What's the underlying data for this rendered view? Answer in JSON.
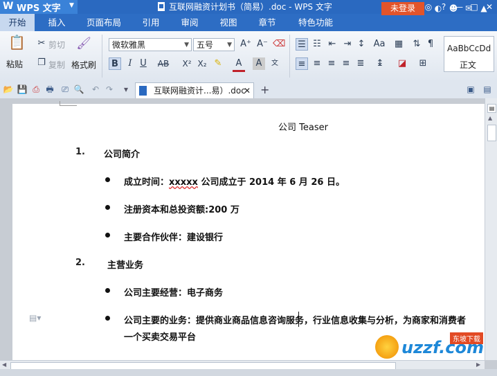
{
  "titlebar": {
    "app_name": "WPS 文字",
    "doc_title": "互联网融资计划书（简易）.doc - WPS 文字",
    "controls": [
      "◎",
      "?",
      "—",
      "□",
      "✕"
    ]
  },
  "menu": {
    "tabs": [
      "开始",
      "插入",
      "页面布局",
      "引用",
      "审阅",
      "视图",
      "章节",
      "特色功能"
    ],
    "active": "开始",
    "login": "未登录",
    "icons": [
      "◐",
      "☻",
      "✉",
      "▲"
    ]
  },
  "ribbon": {
    "paste": "粘贴",
    "cut": "剪切",
    "copy": "复制",
    "format_painter": "格式刷",
    "font_name": "微软雅黑",
    "font_size": "五号",
    "style_sample": "AaBbCcDd",
    "style_name": "正文",
    "icons": {
      "bold": "B",
      "italic": "I",
      "underline": "U",
      "strike": "AB",
      "superscript": "X²",
      "subscript": "X₂",
      "grow": "A⁺",
      "shrink": "A⁻"
    }
  },
  "quick_access": {
    "doc_tab_title": "互联网融资计...易）.doc",
    "close": "✕",
    "new_tab": "+"
  },
  "document": {
    "header": "公司 Teaser",
    "sections": [
      {
        "number": "1.",
        "title": "公司简介",
        "items": [
          {
            "prefix": "成立时间：",
            "wavy": "xxxxx",
            "rest": " 公司成立于 2014 年 6 月 26 日。"
          },
          {
            "text": "注册资本和总投资额:200 万"
          },
          {
            "text": "主要合作伙伴：建设银行"
          }
        ]
      },
      {
        "number": "2.",
        "title": "主营业务",
        "items": [
          {
            "text": "公司主要经营：电子商务"
          },
          {
            "line1": "公司主要的业务：提供商业商品信息咨询服务，行业信息收集与分析，为商家和消费者",
            "line2": "一个买卖交易平台"
          }
        ]
      }
    ]
  },
  "watermark": {
    "brand": "uzzf.com",
    "tag": "东坡下载"
  }
}
